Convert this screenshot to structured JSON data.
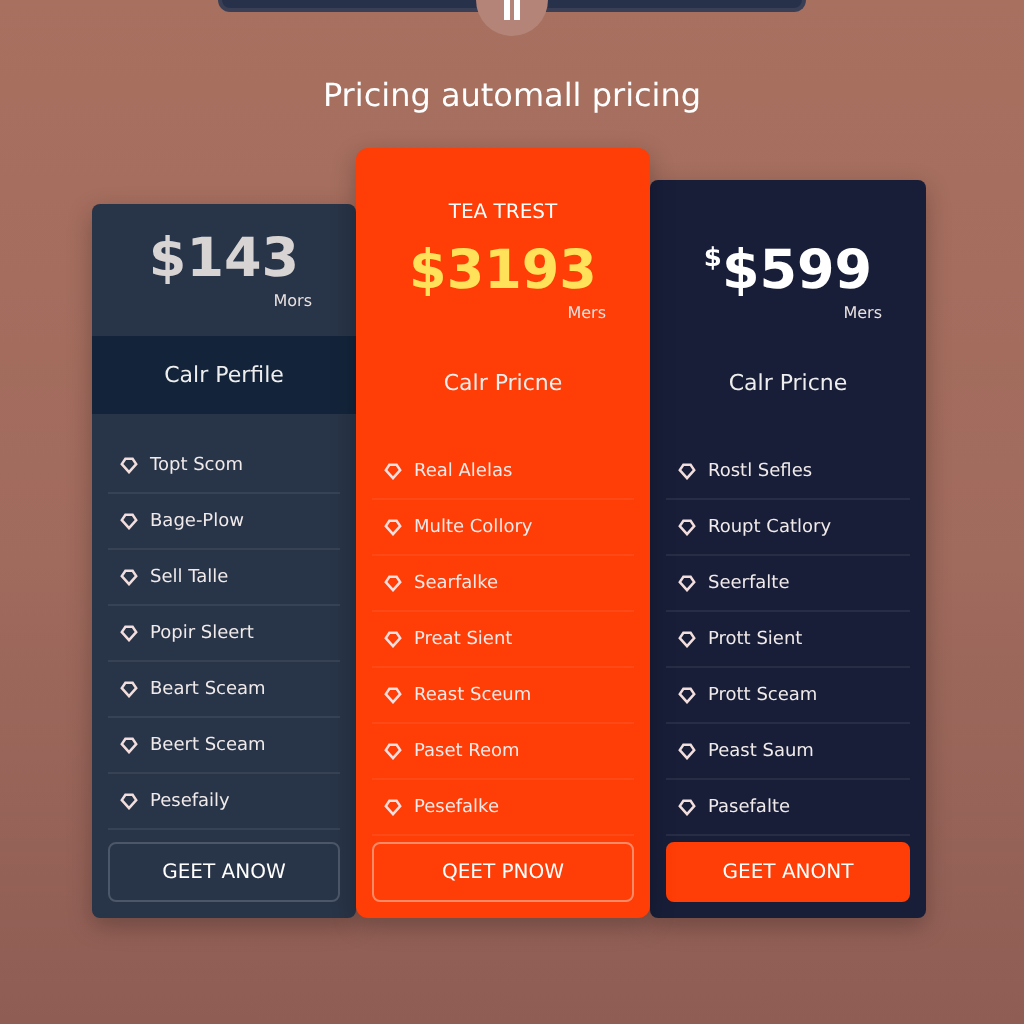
{
  "heading": "Pricing automall pricing",
  "plans": [
    {
      "kind": "plain",
      "price": "$143",
      "period": "Mors",
      "name": "Calr Perfile",
      "features": [
        "Topt Scom",
        "Bage-Plow",
        "Sell Talle",
        "Popir Sleert",
        "Beart Sceam",
        "Beert Sceam",
        "Pesefaily"
      ],
      "button": "GEET ANOW"
    },
    {
      "kind": "featured",
      "badge": "TEA TREST",
      "price": "$3193",
      "period": "Mers",
      "name": "Calr Pricne",
      "features": [
        "Real Alelas",
        "Multe Collory",
        "Searfalke",
        "Preat Sient",
        "Reast Sceum",
        "Paset Reom",
        "Pesefalke"
      ],
      "button": "QEET PNOW"
    },
    {
      "kind": "dark",
      "currency": "$",
      "price": "$599",
      "period": "Mers",
      "name": "Calr Pricne",
      "features": [
        "Rostl Sefles",
        "Roupt Catlory",
        "Seerfalte",
        "Prott Sient",
        "Prott Sceam",
        "Peast Saum",
        "Pasefalte"
      ],
      "button": "GEET ANONT"
    }
  ]
}
